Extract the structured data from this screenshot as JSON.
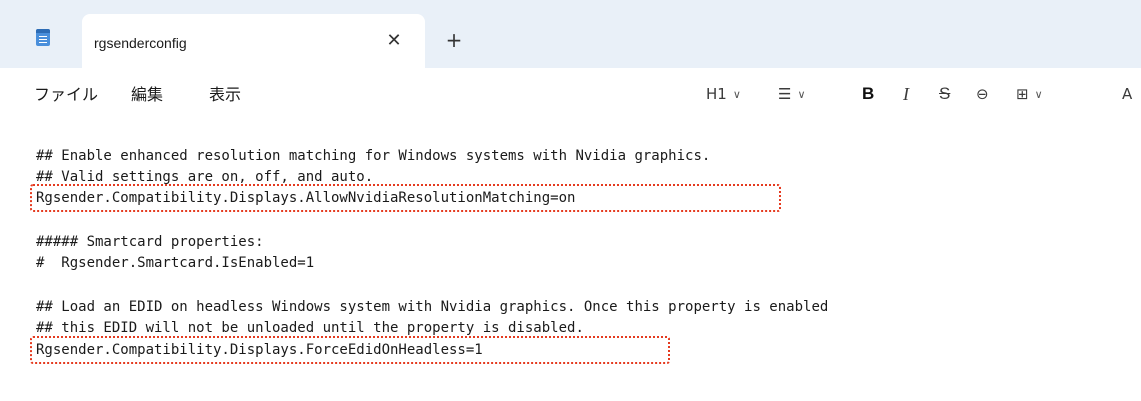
{
  "window": {
    "tab_title": "rgsenderconfig",
    "close_glyph": "✕",
    "new_tab_glyph": "+"
  },
  "menu": {
    "items": [
      "ファイル",
      "編集",
      "表示"
    ]
  },
  "toolbar": {
    "heading_label": "H1",
    "chevron": "∨",
    "list_glyph": "☰",
    "bold_label": "B",
    "italic_label": "I",
    "strike_label": "S",
    "link_glyph": "⊖",
    "table_glyph": "⊞",
    "more_label": "A"
  },
  "editor": {
    "lines": [
      "## Enable enhanced resolution matching for Windows systems with Nvidia graphics.",
      "## Valid settings are on, off, and auto.",
      "Rgsender.Compatibility.Displays.AllowNvidiaResolutionMatching=on",
      "##### Smartcard properties:",
      "#  Rgsender.Smartcard.IsEnabled=1",
      "## Load an EDID on headless Windows system with Nvidia graphics. Once this property is enabled",
      "## this EDID will not be unloaded until the property is disabled.",
      "Rgsender.Compatibility.Displays.ForceEdidOnHeadless=1"
    ],
    "highlight_color": "#e53a1f"
  }
}
